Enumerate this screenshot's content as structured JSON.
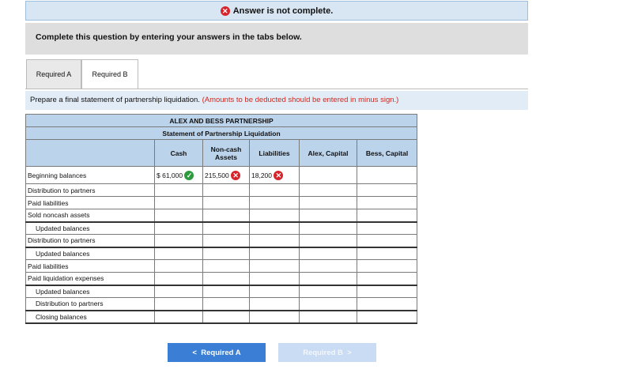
{
  "banner": {
    "text": "Answer is not complete."
  },
  "instructions": "Complete this question by entering your answers in the tabs below.",
  "tabs": [
    {
      "label": "Required A"
    },
    {
      "label": "Required B"
    }
  ],
  "prompt": {
    "text": "Prepare a final statement of partnership liquidation.",
    "note": "(Amounts to be deducted should be entered in minus sign.)"
  },
  "table": {
    "title": "ALEX AND BESS PARTNERSHIP",
    "subtitle": "Statement of Partnership Liquidation",
    "columns": [
      "Cash",
      "Non-cash Assets",
      "Liabilities",
      "Alex, Capital",
      "Bess, Capital"
    ],
    "rows": [
      {
        "label": "Beginning balances",
        "cash": "$ 61,000",
        "noncash": "215,500",
        "liabilities": "18,200"
      },
      {
        "label": "Distribution to partners"
      },
      {
        "label": "Paid liabilities"
      },
      {
        "label": "Sold noncash assets"
      },
      {
        "label": "Updated balances"
      },
      {
        "label": "Distribution to partners"
      },
      {
        "label": "Updated balances"
      },
      {
        "label": "Paid liabilities"
      },
      {
        "label": "Paid liquidation expenses"
      },
      {
        "label": "Updated balances"
      },
      {
        "label": "Distribution to partners"
      },
      {
        "label": "Closing balances"
      }
    ]
  },
  "nav": {
    "prev": "Required A",
    "next": "Required B"
  }
}
